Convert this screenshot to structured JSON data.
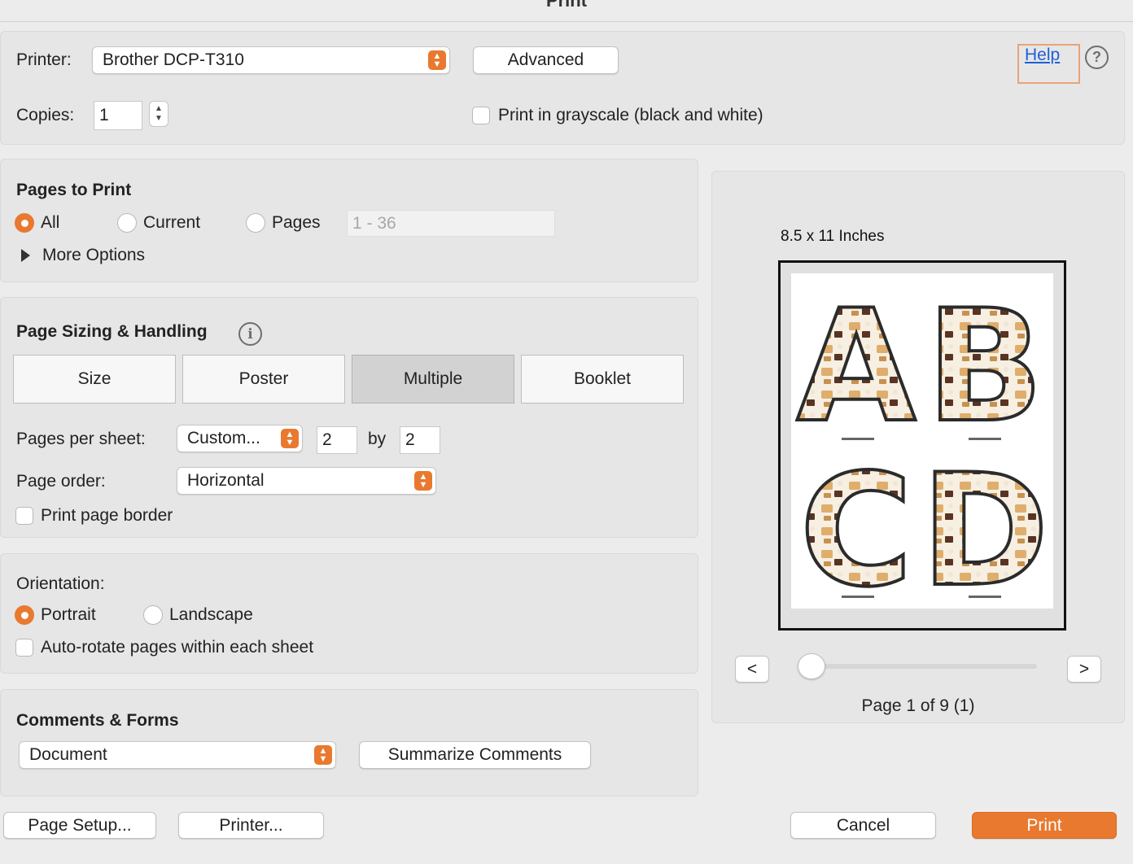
{
  "window": {
    "title": "Print"
  },
  "printer": {
    "label": "Printer:",
    "selected": "Brother DCP-T310",
    "advanced_label": "Advanced",
    "help_label": "Help",
    "help_icon": "?"
  },
  "copies": {
    "label": "Copies:",
    "value": "1"
  },
  "grayscale": {
    "label": "Print in grayscale (black and white)",
    "checked": false
  },
  "pages_to_print": {
    "heading": "Pages to Print",
    "options": [
      "All",
      "Current",
      "Pages"
    ],
    "selected": "All",
    "range_placeholder": "1 - 36",
    "more_options": "More Options"
  },
  "page_sizing": {
    "heading": "Page Sizing & Handling",
    "info_icon": "i",
    "tabs": [
      "Size",
      "Poster",
      "Multiple",
      "Booklet"
    ],
    "selected_tab": "Multiple",
    "pages_per_sheet_label": "Pages per sheet:",
    "pages_per_sheet_value": "Custom...",
    "cols": "2",
    "by_label": "by",
    "rows": "2",
    "page_order_label": "Page order:",
    "page_order_value": "Horizontal",
    "print_border_label": "Print page border"
  },
  "orientation": {
    "heading": "Orientation:",
    "options": [
      "Portrait",
      "Landscape"
    ],
    "selected": "Portrait",
    "auto_rotate_label": "Auto-rotate pages within each sheet"
  },
  "comments_forms": {
    "heading": "Comments & Forms",
    "selected": "Document",
    "summarize_label": "Summarize Comments"
  },
  "preview": {
    "paper_size": "8.5 x 11 Inches",
    "letters": [
      "A",
      "B",
      "C",
      "D"
    ],
    "prev_label": "<",
    "next_label": ">",
    "page_status": "Page 1 of 9 (1)",
    "slider_position": 0
  },
  "footer": {
    "page_setup": "Page Setup...",
    "printer": "Printer...",
    "cancel": "Cancel",
    "print": "Print"
  },
  "colors": {
    "accent": "#e8792f"
  }
}
